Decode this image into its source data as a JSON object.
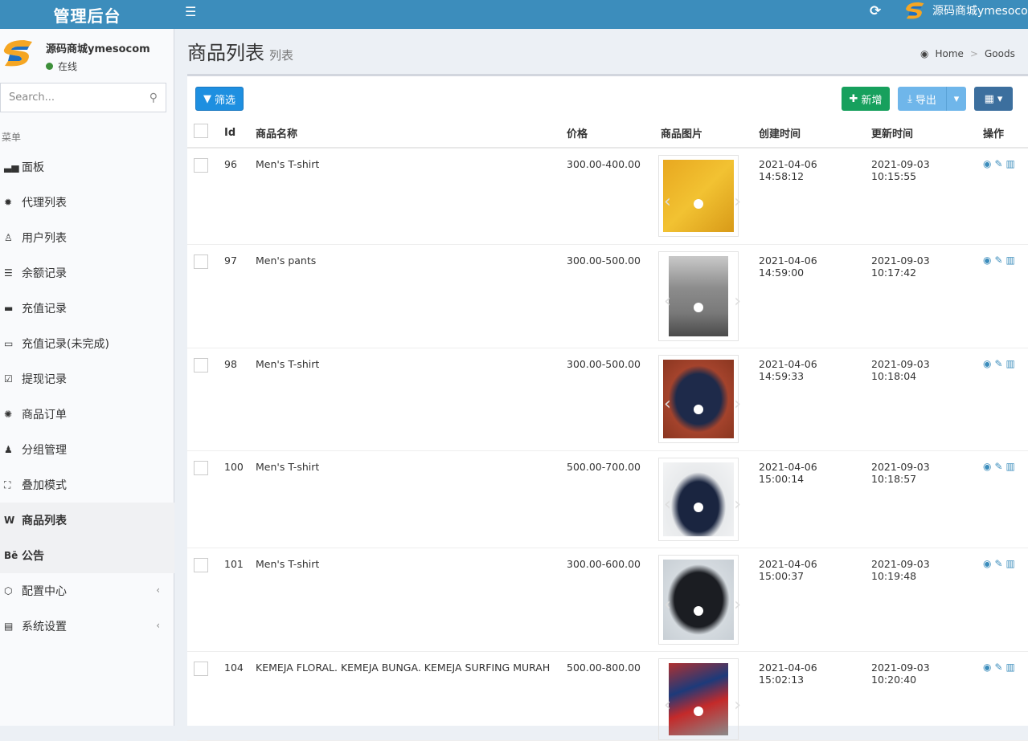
{
  "topbar": {
    "logo": "管理后台",
    "menu_icon": "bars-icon",
    "refresh_icon": "refresh-icon",
    "user_name": "源码商城ymesocom",
    "color": "#3c8dbc"
  },
  "sidebar": {
    "user": {
      "name": "源码商城ymesocom",
      "status": "在线"
    },
    "search_placeholder": "Search...",
    "menu_header": "菜单",
    "items": [
      {
        "label": "面板",
        "icon": "area-chart-icon"
      },
      {
        "label": "代理列表",
        "icon": "gear-icon"
      },
      {
        "label": "用户列表",
        "icon": "user-icon"
      },
      {
        "label": "余额记录",
        "icon": "list-icon"
      },
      {
        "label": "充值记录",
        "icon": "battery-icon"
      },
      {
        "label": "充值记录(未完成)",
        "icon": "battery-empty-icon"
      },
      {
        "label": "提现记录",
        "icon": "check-square-icon"
      },
      {
        "label": "商品订单",
        "icon": "cog-icon"
      },
      {
        "label": "分组管理",
        "icon": "users-icon"
      },
      {
        "label": "叠加模式",
        "icon": "object-group-icon"
      },
      {
        "label": "商品列表",
        "icon": "wikipedia-icon"
      },
      {
        "label": "公告",
        "icon": "behance-icon"
      },
      {
        "label": "配置中心",
        "icon": "cube-icon"
      },
      {
        "label": "系统设置",
        "icon": "list-alt-icon"
      }
    ]
  },
  "header": {
    "title": "商品列表",
    "subtitle": "列表",
    "breadcrumb": [
      "Home",
      "Goods"
    ]
  },
  "toolbar": {
    "filter": "筛选",
    "add": "新增",
    "export": "导出"
  },
  "table": {
    "columns": [
      "Id",
      "商品名称",
      "价格",
      "商品图片",
      "创建时间",
      "更新时间",
      "操作"
    ],
    "rows": [
      {
        "id": "96",
        "name": "Men's T-shirt",
        "price": "300.00-400.00",
        "created": "2021-04-06 14:58:12",
        "updated": "2021-09-03 10:15:55"
      },
      {
        "id": "97",
        "name": "Men's pants",
        "price": "300.00-500.00",
        "created": "2021-04-06 14:59:00",
        "updated": "2021-09-03 10:17:42"
      },
      {
        "id": "98",
        "name": "Men's T-shirt",
        "price": "300.00-500.00",
        "created": "2021-04-06 14:59:33",
        "updated": "2021-09-03 10:18:04"
      },
      {
        "id": "100",
        "name": "Men's T-shirt",
        "price": "500.00-700.00",
        "created": "2021-04-06 15:00:14",
        "updated": "2021-09-03 10:18:57"
      },
      {
        "id": "101",
        "name": "Men's T-shirt",
        "price": "300.00-600.00",
        "created": "2021-04-06 15:00:37",
        "updated": "2021-09-03 10:19:48"
      },
      {
        "id": "104",
        "name": "KEMEJA FLORAL. KEMEJA BUNGA. KEMEJA SURFING MURAH",
        "price": "500.00-800.00",
        "created": "2021-04-06 15:02:13",
        "updated": "2021-09-03 10:20:40"
      }
    ]
  }
}
